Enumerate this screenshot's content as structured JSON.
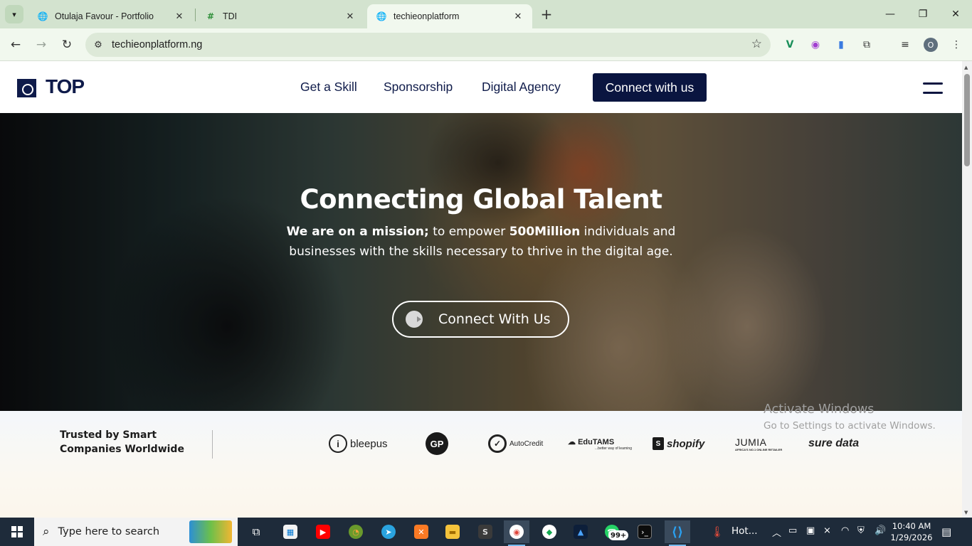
{
  "browser": {
    "tabs": [
      {
        "title": "Otulaja Favour - Portfolio",
        "favicon": "globe-icon"
      },
      {
        "title": "TDI",
        "favicon": "tdi-logo-icon"
      },
      {
        "title": "techieonplatform",
        "favicon": "globe-icon",
        "active": true
      }
    ],
    "new_tab_symbol": "+",
    "url": "techieonplatform.ng",
    "profile_initial": "O"
  },
  "site": {
    "logo_text": "TOP",
    "nav": [
      "Get a Skill",
      "Sponsorship",
      "Digital Agency"
    ],
    "cta": "Connect with us",
    "hero": {
      "title": "Connecting Global Talent",
      "subtitle_bold1": "We are on a mission;",
      "subtitle_text1": " to empower ",
      "subtitle_bold2": "500Million",
      "subtitle_text2": " individuals and businesses with the skills necessary to thrive in the digital age.",
      "button": "Connect With Us"
    },
    "trusted": {
      "text": "Trusted by Smart Companies Worldwide",
      "partners": [
        "bleepus",
        "GP",
        "AutoCredit",
        "EduTAMS",
        "shopify",
        "JUMIA",
        "sure data"
      ],
      "jumia_tagline": "AFRICA'S NO.1 ONLINE RETAILER",
      "edutams_tagline": "...better way of learning"
    }
  },
  "windows_watermark": {
    "title": "Activate Windows",
    "subtitle": "Go to Settings to activate Windows."
  },
  "taskbar": {
    "search_placeholder": "Type here to search",
    "whatsapp_badge": "99+",
    "weather_text": "Hot...",
    "time": "10:40 AM",
    "date": "1/29/2026"
  },
  "colors": {
    "brand_navy": "#0a1540",
    "chrome_tabstrip": "#d3e3cf",
    "chrome_toolbar": "#f1f8ee",
    "taskbar": "#1e2b3a"
  }
}
